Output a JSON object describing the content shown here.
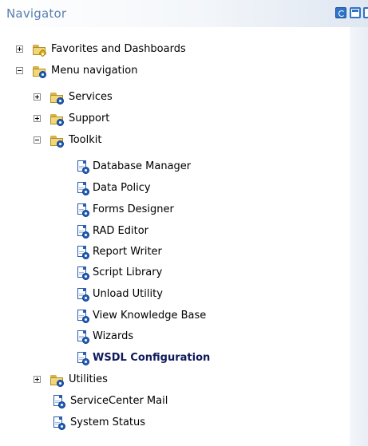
{
  "header": {
    "title": "Navigator",
    "icons": [
      "refresh-icon",
      "document-icon",
      "new-window-icon"
    ]
  },
  "tree": {
    "favorites": {
      "label": "Favorites and Dashboards",
      "expanded": false
    },
    "menu_navigation": {
      "label": "Menu navigation",
      "expanded": true
    },
    "services": {
      "label": "Services",
      "expanded": false
    },
    "support": {
      "label": "Support",
      "expanded": false
    },
    "toolkit": {
      "label": "Toolkit",
      "expanded": true
    },
    "toolkit_items": [
      {
        "label": "Database Manager"
      },
      {
        "label": "Data Policy"
      },
      {
        "label": "Forms Designer"
      },
      {
        "label": "RAD Editor"
      },
      {
        "label": "Report Writer"
      },
      {
        "label": "Script Library"
      },
      {
        "label": "Unload Utility"
      },
      {
        "label": "View Knowledge Base"
      },
      {
        "label": "Wizards"
      },
      {
        "label": "WSDL Configuration",
        "selected": true
      }
    ],
    "utilities": {
      "label": "Utilities",
      "expanded": false
    },
    "servicecenter_mail": {
      "label": "ServiceCenter Mail"
    },
    "system_status": {
      "label": "System Status"
    }
  },
  "colors": {
    "header_title": "#5a7fb0",
    "icon_blue": "#2f74c9",
    "folder_yellow": "#f2d77a",
    "selected_text": "#0f1a5c"
  }
}
